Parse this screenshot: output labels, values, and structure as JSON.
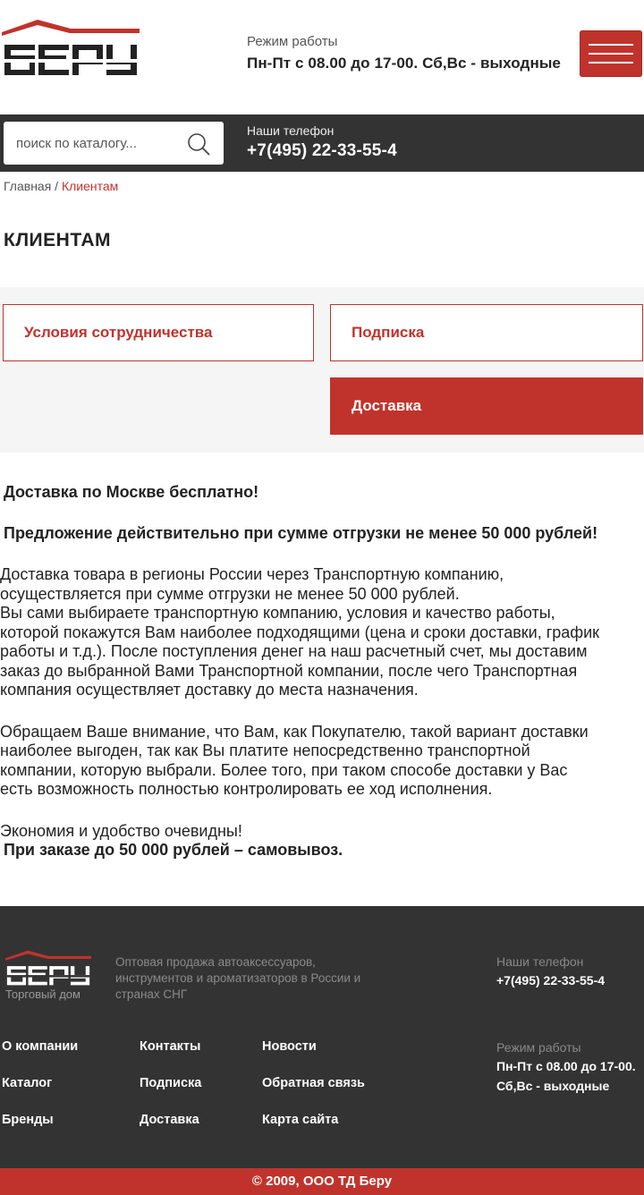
{
  "brand": {
    "logo_text": "БЕРУ",
    "accent": "#c0332c",
    "dark": "#333333"
  },
  "header": {
    "hours_label": "Режим работы",
    "hours_value": "Пн-Пт с 08.00 до 17-00. Сб,Вс - выходные",
    "menu_icon": "hamburger-icon"
  },
  "search": {
    "placeholder": "поиск по каталогу...",
    "icon": "search-icon"
  },
  "phones": {
    "label": "Наши телефон",
    "value": "+7(495) 22-33-55-4"
  },
  "breadcrumb": {
    "home": "Главная",
    "separator": " / ",
    "current": "Клиентам"
  },
  "page_title": "КЛИЕНТАМ",
  "tabs": [
    {
      "label": "Условия сотрудничества",
      "active": false
    },
    {
      "label": "Подписка",
      "active": false
    },
    {
      "label": "Доставка",
      "active": true
    }
  ],
  "content": {
    "heading1": "Доставка по Москве бесплатно!",
    "heading2": "Предложение действительно при сумме отгрузки не менее 50 000 рублей!",
    "para1_lines": [
      " Доставка товара в регионы России через Транспортную компанию,",
      "осуществляется при сумме отгрузки не менее 50 000 рублей.",
      "  Вы сами выбираете транспортную компанию, условия и качество работы,",
      "которой покажутся Вам наиболее подходящими (цена и сроки доставки, график",
      "работы и т.д.). После поступления денег на наш расчетный счет, мы доставим",
      "заказ до выбранной Вами Транспортной компании, после чего Транспортная",
      "компания осуществляет доставку до места назначения."
    ],
    "para2_lines": [
      " Обращаем Ваше внимание, что Вам, как Покупателю, такой вариант доставки",
      "наиболее выгоден, так как Вы платите непосредственно транспортной",
      "компании, которую выбрали. Более того, при таком способе доставки у Вас",
      "есть возможность полностью контролировать ее ход исполнения."
    ],
    "para3": " Экономия и удобство очевидны!",
    "para4": "При заказе до 50 000 рублей – самовывоз."
  },
  "footer": {
    "subtitle": "Торговый дом",
    "description": "Оптовая продажа автоаксессуаров, инструментов и ароматизаторов в России и странах СНГ",
    "phones_label": "Наши телефон",
    "phones_value": "+7(495) 22-33-55-4",
    "hours_label": "Режим работы",
    "hours_line1": "Пн-Пт с 08.00 до 17-00.",
    "hours_line2": "Сб,Вс - выходные",
    "nav": [
      [
        "О компании",
        "Контакты",
        "Новости"
      ],
      [
        "Каталог",
        "Подписка",
        "Обратная связь"
      ],
      [
        "Бренды",
        "Доставка",
        "Карта сайта"
      ]
    ],
    "copyright": "© 2009, ООО ТД Беру"
  }
}
